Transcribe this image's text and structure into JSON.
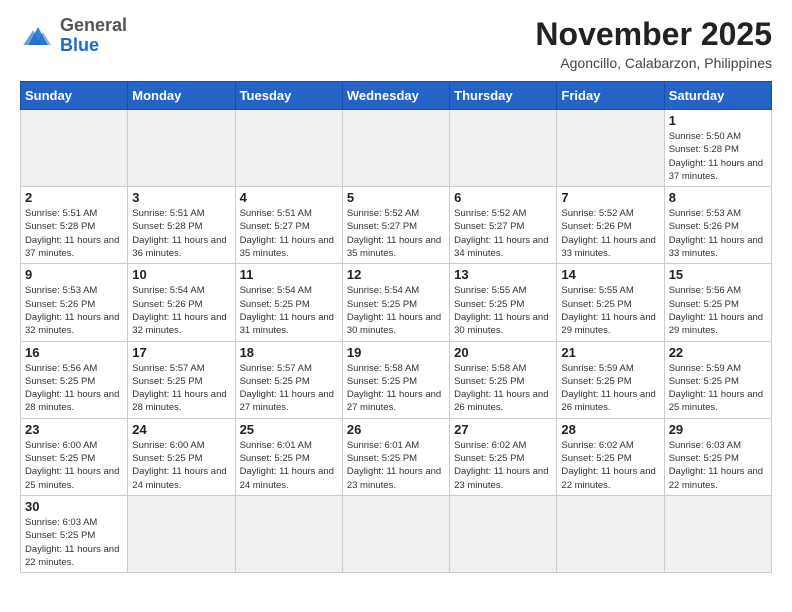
{
  "header": {
    "logo_general": "General",
    "logo_blue": "Blue",
    "month_title": "November 2025",
    "location": "Agoncillo, Calabarzon, Philippines"
  },
  "weekdays": [
    "Sunday",
    "Monday",
    "Tuesday",
    "Wednesday",
    "Thursday",
    "Friday",
    "Saturday"
  ],
  "weeks": [
    [
      {
        "day": "",
        "text": ""
      },
      {
        "day": "",
        "text": ""
      },
      {
        "day": "",
        "text": ""
      },
      {
        "day": "",
        "text": ""
      },
      {
        "day": "",
        "text": ""
      },
      {
        "day": "",
        "text": ""
      },
      {
        "day": "1",
        "text": "Sunrise: 5:50 AM\nSunset: 5:28 PM\nDaylight: 11 hours and 37 minutes."
      }
    ],
    [
      {
        "day": "2",
        "text": "Sunrise: 5:51 AM\nSunset: 5:28 PM\nDaylight: 11 hours and 37 minutes."
      },
      {
        "day": "3",
        "text": "Sunrise: 5:51 AM\nSunset: 5:28 PM\nDaylight: 11 hours and 36 minutes."
      },
      {
        "day": "4",
        "text": "Sunrise: 5:51 AM\nSunset: 5:27 PM\nDaylight: 11 hours and 35 minutes."
      },
      {
        "day": "5",
        "text": "Sunrise: 5:52 AM\nSunset: 5:27 PM\nDaylight: 11 hours and 35 minutes."
      },
      {
        "day": "6",
        "text": "Sunrise: 5:52 AM\nSunset: 5:27 PM\nDaylight: 11 hours and 34 minutes."
      },
      {
        "day": "7",
        "text": "Sunrise: 5:52 AM\nSunset: 5:26 PM\nDaylight: 11 hours and 33 minutes."
      },
      {
        "day": "8",
        "text": "Sunrise: 5:53 AM\nSunset: 5:26 PM\nDaylight: 11 hours and 33 minutes."
      }
    ],
    [
      {
        "day": "9",
        "text": "Sunrise: 5:53 AM\nSunset: 5:26 PM\nDaylight: 11 hours and 32 minutes."
      },
      {
        "day": "10",
        "text": "Sunrise: 5:54 AM\nSunset: 5:26 PM\nDaylight: 11 hours and 32 minutes."
      },
      {
        "day": "11",
        "text": "Sunrise: 5:54 AM\nSunset: 5:25 PM\nDaylight: 11 hours and 31 minutes."
      },
      {
        "day": "12",
        "text": "Sunrise: 5:54 AM\nSunset: 5:25 PM\nDaylight: 11 hours and 30 minutes."
      },
      {
        "day": "13",
        "text": "Sunrise: 5:55 AM\nSunset: 5:25 PM\nDaylight: 11 hours and 30 minutes."
      },
      {
        "day": "14",
        "text": "Sunrise: 5:55 AM\nSunset: 5:25 PM\nDaylight: 11 hours and 29 minutes."
      },
      {
        "day": "15",
        "text": "Sunrise: 5:56 AM\nSunset: 5:25 PM\nDaylight: 11 hours and 29 minutes."
      }
    ],
    [
      {
        "day": "16",
        "text": "Sunrise: 5:56 AM\nSunset: 5:25 PM\nDaylight: 11 hours and 28 minutes."
      },
      {
        "day": "17",
        "text": "Sunrise: 5:57 AM\nSunset: 5:25 PM\nDaylight: 11 hours and 28 minutes."
      },
      {
        "day": "18",
        "text": "Sunrise: 5:57 AM\nSunset: 5:25 PM\nDaylight: 11 hours and 27 minutes."
      },
      {
        "day": "19",
        "text": "Sunrise: 5:58 AM\nSunset: 5:25 PM\nDaylight: 11 hours and 27 minutes."
      },
      {
        "day": "20",
        "text": "Sunrise: 5:58 AM\nSunset: 5:25 PM\nDaylight: 11 hours and 26 minutes."
      },
      {
        "day": "21",
        "text": "Sunrise: 5:59 AM\nSunset: 5:25 PM\nDaylight: 11 hours and 26 minutes."
      },
      {
        "day": "22",
        "text": "Sunrise: 5:59 AM\nSunset: 5:25 PM\nDaylight: 11 hours and 25 minutes."
      }
    ],
    [
      {
        "day": "23",
        "text": "Sunrise: 6:00 AM\nSunset: 5:25 PM\nDaylight: 11 hours and 25 minutes."
      },
      {
        "day": "24",
        "text": "Sunrise: 6:00 AM\nSunset: 5:25 PM\nDaylight: 11 hours and 24 minutes."
      },
      {
        "day": "25",
        "text": "Sunrise: 6:01 AM\nSunset: 5:25 PM\nDaylight: 11 hours and 24 minutes."
      },
      {
        "day": "26",
        "text": "Sunrise: 6:01 AM\nSunset: 5:25 PM\nDaylight: 11 hours and 23 minutes."
      },
      {
        "day": "27",
        "text": "Sunrise: 6:02 AM\nSunset: 5:25 PM\nDaylight: 11 hours and 23 minutes."
      },
      {
        "day": "28",
        "text": "Sunrise: 6:02 AM\nSunset: 5:25 PM\nDaylight: 11 hours and 22 minutes."
      },
      {
        "day": "29",
        "text": "Sunrise: 6:03 AM\nSunset: 5:25 PM\nDaylight: 11 hours and 22 minutes."
      }
    ],
    [
      {
        "day": "30",
        "text": "Sunrise: 6:03 AM\nSunset: 5:25 PM\nDaylight: 11 hours and 22 minutes."
      },
      {
        "day": "",
        "text": ""
      },
      {
        "day": "",
        "text": ""
      },
      {
        "day": "",
        "text": ""
      },
      {
        "day": "",
        "text": ""
      },
      {
        "day": "",
        "text": ""
      },
      {
        "day": "",
        "text": ""
      }
    ]
  ]
}
